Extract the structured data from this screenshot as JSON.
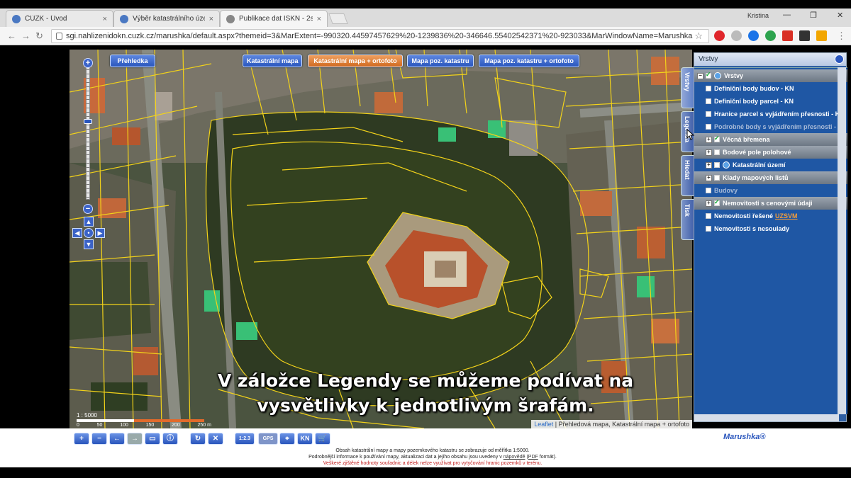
{
  "browser": {
    "tabs": [
      {
        "title": "ČÚZK - Úvod",
        "active": false
      },
      {
        "title": "Výběr katastrálního úzen",
        "active": false
      },
      {
        "title": "Publikace dat ISKN - 2s",
        "active": true
      }
    ],
    "user": "Kristina",
    "url": "sgi.nahlizenidokn.cuzk.cz/marushka/default.aspx?themeid=3&MarExtent=-990320.44597457629%20-1239836%20-346646.55402542371%20-923033&MarWindowName=Marushka",
    "close_glyph": "×",
    "extensions": [
      "opera-icon",
      "grey-icon",
      "play-icon",
      "green-icon",
      "red-icon",
      "dark-icon",
      "mail-icon",
      "menu-icon"
    ]
  },
  "map": {
    "overview_label": "Přehledka",
    "layer_buttons": [
      {
        "label": "Katastrální mapa",
        "style": "blue"
      },
      {
        "label": "Katastrální mapa + ortofoto",
        "style": "orange"
      },
      {
        "label": "Mapa poz. katastru",
        "style": "blue"
      },
      {
        "label": "Mapa poz. katastru + ortofoto",
        "style": "blue"
      }
    ],
    "scale": {
      "ratio": "1 : 5000",
      "ticks": [
        "0",
        "50",
        "100",
        "150",
        "200",
        "250 m"
      ]
    },
    "attribution": {
      "link": "Leaflet",
      "text": "| Přehledová mapa, Katastrální mapa + ortofoto"
    }
  },
  "sidetabs": [
    "Vrstvy",
    "Legenda",
    "Hledat",
    "Tisk"
  ],
  "panel": {
    "title": "Vrstvy",
    "layers": [
      {
        "label": "Vrstvy",
        "checked": true,
        "expander": "−",
        "icon": true,
        "style": "bar"
      },
      {
        "label": "Definiční body budov - KN",
        "checked": false,
        "style": "normal"
      },
      {
        "label": "Definiční body parcel - KN",
        "checked": false,
        "style": "normal"
      },
      {
        "label": "Hranice parcel s vyjádřením přesnosti - K",
        "checked": false,
        "style": "normal"
      },
      {
        "label": "Podrobné body s vyjádřením přesnosti - K",
        "checked": false,
        "style": "grey"
      },
      {
        "label": "Věcná břemena",
        "checked": true,
        "expander": "+",
        "style": "bar"
      },
      {
        "label": "Bodové pole polohové",
        "checked": false,
        "expander": "+",
        "style": "bar"
      },
      {
        "label": "Katastrální území",
        "checked": false,
        "expander": "+",
        "icon": true,
        "style": "normal"
      },
      {
        "label": "Klady mapových listů",
        "checked": false,
        "expander": "+",
        "style": "bar"
      },
      {
        "label": "Budovy",
        "checked": false,
        "style": "grey"
      },
      {
        "label": "Nemovitosti s cenovými údaji",
        "checked": true,
        "expander": "+",
        "style": "bar"
      },
      {
        "label": "Nemovitosti řešené",
        "link": "UZSVM",
        "checked": false,
        "style": "normal"
      },
      {
        "label": "Nemovitosti s nesoulady",
        "checked": false,
        "style": "normal"
      }
    ]
  },
  "bottom_toolbar": {
    "tools": [
      "+",
      "−",
      "←",
      "→",
      "▭",
      "ⓘ",
      "↻",
      "✕",
      "1:2.3",
      "GPS",
      "⌖",
      "KN",
      "🛒"
    ],
    "brand": "Marushka®"
  },
  "footer": {
    "line1": "Obsah katastrální mapy a mapy pozemkového katastru se zobrazuje od měřítka 1:5000.",
    "line2_a": "Podrobnější informace k používání mapy, aktualizaci dat a jejího obsahu jsou uvedeny v",
    "line2_link1": "nápovědě",
    "line2_b": "(",
    "line2_link2": "PDF",
    "line2_c": "formát).",
    "line3": "Veškeré zjištěné hodnoty souřadnic a délek nelze využívat pro vytyčování hranic pozemků v terénu."
  },
  "subtitle": {
    "line1": "V záložce Legendy se můžeme podívat na",
    "line2": "vysvětlivky k jednotlivým šrafám."
  },
  "colors": {
    "parcel_lines": "#f2d21a",
    "panel": "#1f57a4",
    "accent": "#2a56bd",
    "orange": "#d06a20"
  }
}
